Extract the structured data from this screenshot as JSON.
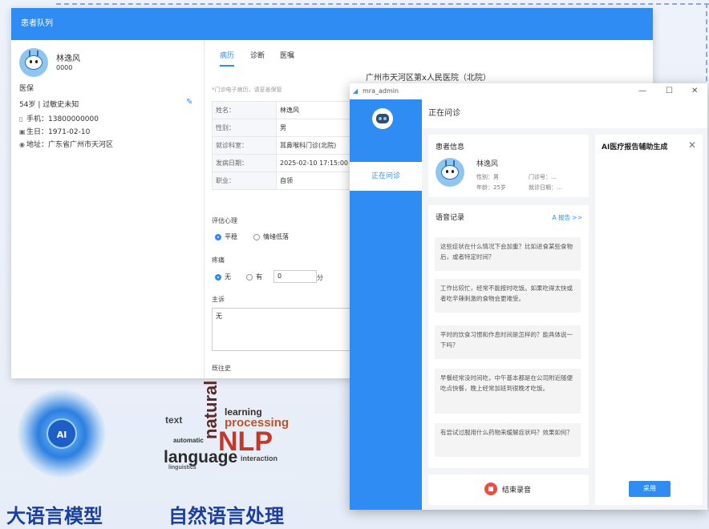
{
  "back_window": {
    "title": "患者队列",
    "patient": {
      "name": "林逸风",
      "id": "0000",
      "insurance": "医保",
      "age_allergy": "54岁 | 过敏史未知",
      "phone": "手机：13800000000",
      "birthday": "生日：1971-02-10",
      "address": "地址：广东省广州市天河区"
    },
    "tabs": [
      "病历",
      "诊断",
      "医嘱"
    ],
    "hospital": "广州市天河区第x人民医院（北院）",
    "hint": "*门诊电子病历，请妥善保管",
    "record": [
      {
        "label": "姓名：",
        "value": "林逸风"
      },
      {
        "label": "性别：",
        "value": "男"
      },
      {
        "label": "就诊科室：",
        "value": "耳鼻喉科门诊(北院)"
      },
      {
        "label": "发病日期：",
        "value": "2025-02-10 17:15:00"
      },
      {
        "label": "职业：",
        "value": "自领"
      }
    ],
    "mood_label": "评估心理",
    "mood_options": [
      "平稳",
      "情绪低落"
    ],
    "pain_label": "疼痛",
    "pain_options": [
      "无",
      "有"
    ],
    "pain_value": "0",
    "pain_unit": "分",
    "complaint_label": "主诉",
    "complaint_value": "无",
    "next_label": "既往史"
  },
  "front_window": {
    "app_name": "mra_admin",
    "controls": [
      "—",
      "☐",
      "✕"
    ],
    "sidebar_item": "正在问诊",
    "header": "正在问诊",
    "patient_info": {
      "title": "患者信息",
      "name": "林逸风",
      "gender": "性别：男",
      "clinic_no": "门诊号：...",
      "age": "年龄：25岁",
      "visit_date": "就诊日期：..."
    },
    "voice": {
      "title": "语音记录",
      "report_link": "A 报告 >>",
      "messages": [
        "这些症状在什么情况下会加重？比如进食某些食物后，或者特定时间？",
        "工作比较忙，经常不能按时吃饭。如果吃得太快或者吃辛辣刺激的食物会更难受。",
        "平时的饮食习惯和作息时间是怎样的？能具体说一下吗？",
        "早餐经常没时间吃，中午基本都是在公司附近随便吃点快餐，晚上经常加班到很晚才吃饭。",
        "有尝试过服用什么药物来缓解症状吗？效果如何？"
      ]
    },
    "stop_label": "结束录音",
    "ai_panel": {
      "title": "AI医疗报告辅助生成",
      "close": "✕",
      "apply": "采用"
    }
  },
  "decor": {
    "ai_badge": "AI",
    "cloud_words": [
      "natural",
      "learning",
      "processing",
      "NLP",
      "language",
      "automatic",
      "linguistics",
      "interaction",
      "text"
    ],
    "caption_left": "大语言模型",
    "caption_right": "自然语言处理"
  },
  "colors": {
    "accent": "#2f8cf3",
    "caption": "#1a3fa0",
    "stop": "#f04b42"
  }
}
